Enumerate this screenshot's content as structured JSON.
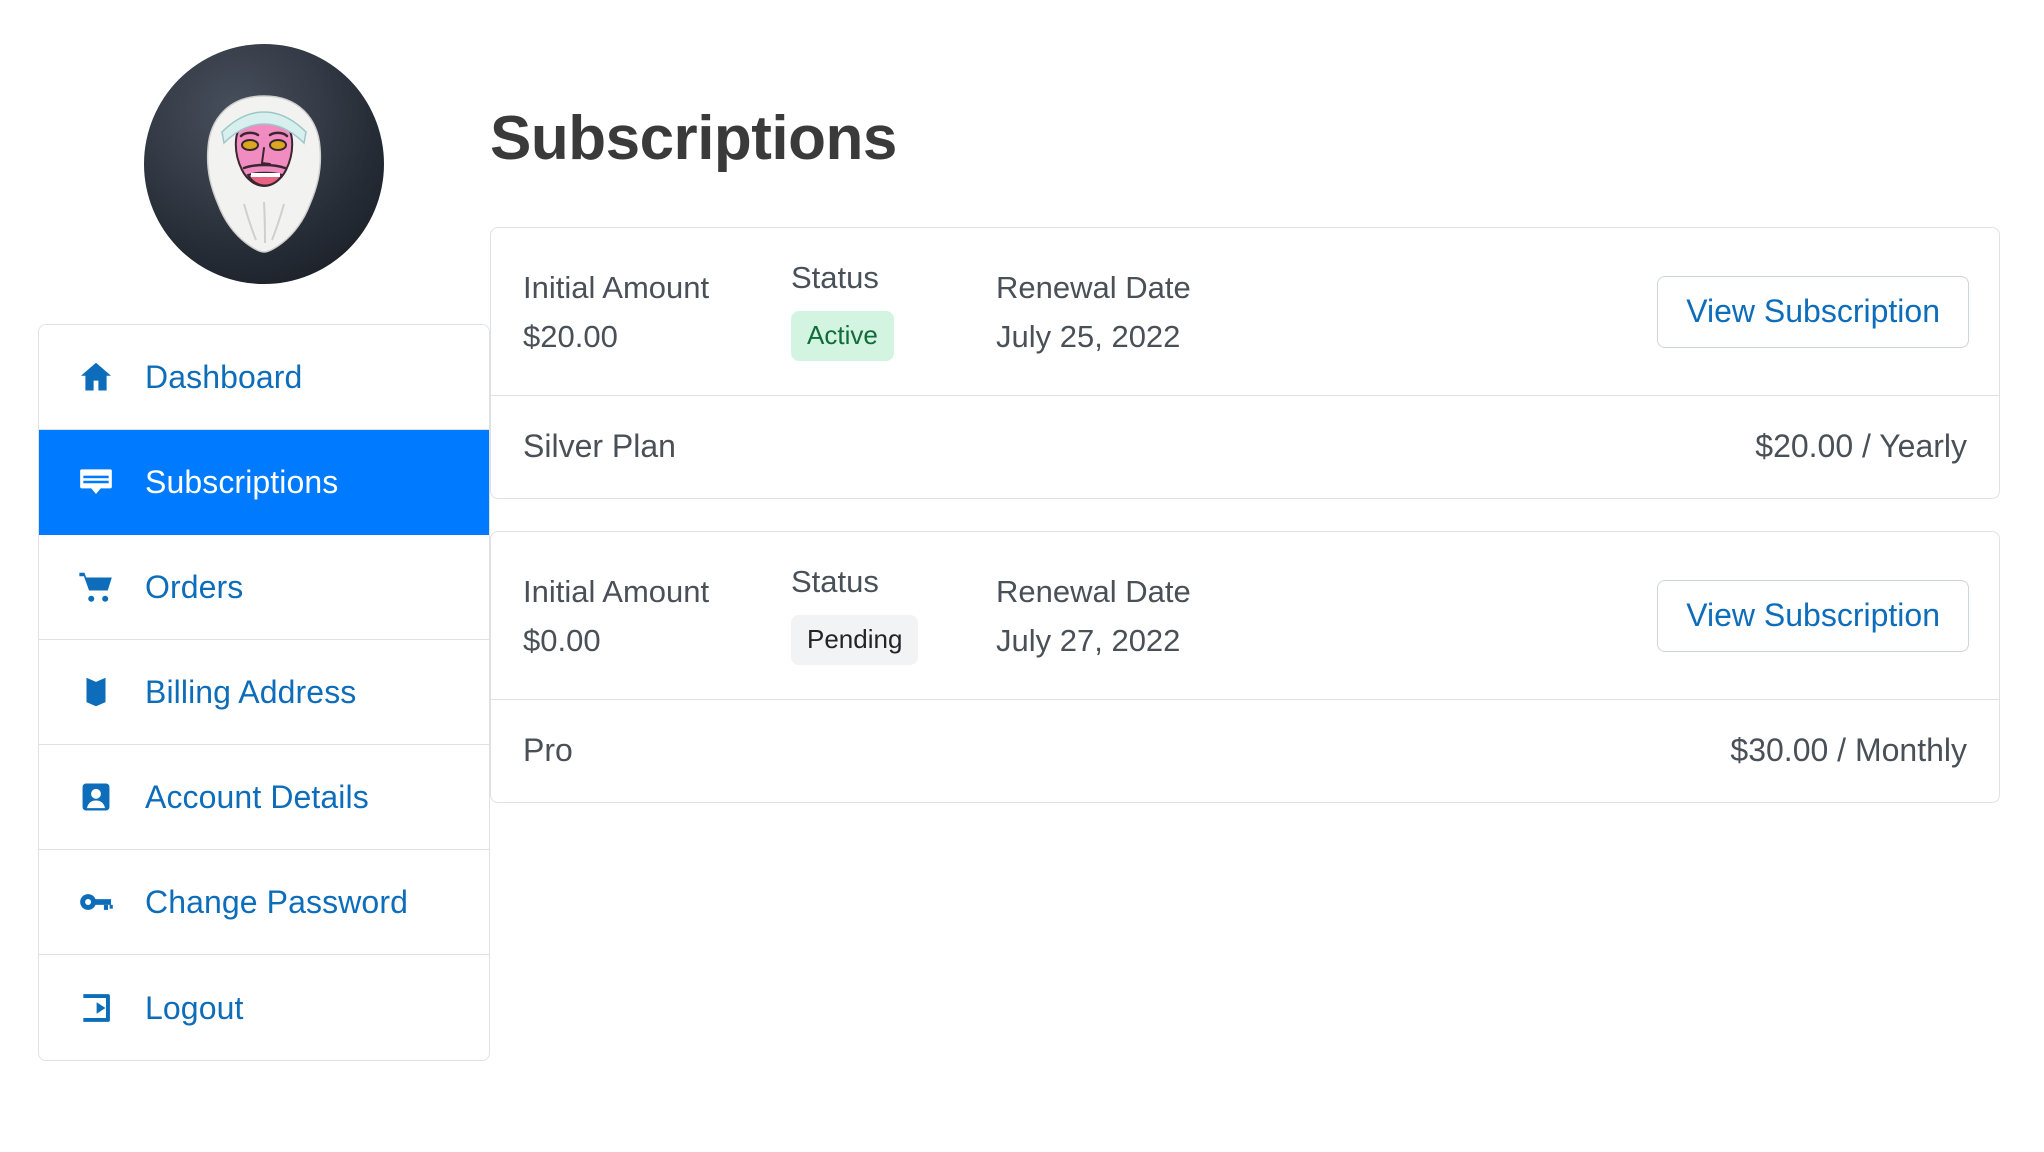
{
  "account": {
    "avatar_alt": "user-avatar"
  },
  "sidebar": {
    "items": [
      {
        "label": "Dashboard",
        "icon": "home-icon",
        "active": false
      },
      {
        "label": "Subscriptions",
        "icon": "subscription-icon",
        "active": true
      },
      {
        "label": "Orders",
        "icon": "cart-icon",
        "active": false
      },
      {
        "label": "Billing Address",
        "icon": "map-icon",
        "active": false
      },
      {
        "label": "Account Details",
        "icon": "person-icon",
        "active": false
      },
      {
        "label": "Change Password",
        "icon": "key-icon",
        "active": false
      },
      {
        "label": "Logout",
        "icon": "logout-icon",
        "active": false
      }
    ]
  },
  "main": {
    "title": "Subscriptions",
    "labels": {
      "initial_amount": "Initial Amount",
      "status": "Status",
      "renewal_date": "Renewal Date",
      "view_subscription": "View Subscription"
    },
    "subscriptions": [
      {
        "initial_amount": "$20.00",
        "status": "Active",
        "status_kind": "active",
        "renewal_date": "July 25, 2022",
        "action": "View Subscription",
        "plan_name": "Silver Plan",
        "plan_price": "$20.00 / Yearly"
      },
      {
        "initial_amount": "$0.00",
        "status": "Pending",
        "status_kind": "pending",
        "renewal_date": "July 27, 2022",
        "action": "View Subscription",
        "plan_name": "Pro",
        "plan_price": "$30.00 / Monthly"
      }
    ]
  },
  "colors": {
    "accent_blue": "#007bff",
    "link_blue": "#0d6dba",
    "badge_active_bg": "#d2f4e1",
    "badge_active_text": "#136b3c",
    "badge_pending_bg": "#f1f3f5",
    "badge_pending_text": "#212529",
    "border": "#dee2e6",
    "text": "#495057",
    "title": "#3a3a3a"
  }
}
